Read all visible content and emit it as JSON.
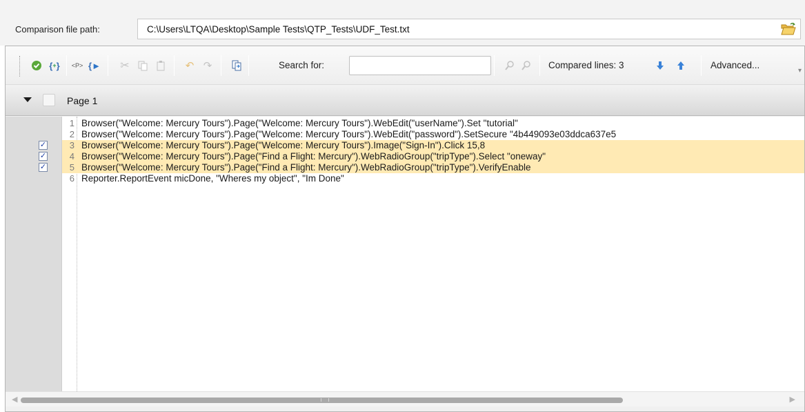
{
  "path": {
    "label": "Comparison file path:",
    "value": "C:\\Users\\LTQA\\Desktop\\Sample Tests\\QTP_Tests\\UDF_Test.txt",
    "browse_icon": "folder-open-icon"
  },
  "toolbar": {
    "icons": [
      "check-green-icon",
      "insert-function-icon",
      "insert-parameter-icon",
      "step-into-function-icon",
      "cut-icon",
      "copy-icon",
      "paste-icon",
      "undo-icon",
      "redo-icon",
      "copy-steps-icon",
      "find-icon",
      "find-next-icon",
      "arrow-down-icon",
      "arrow-up-icon"
    ],
    "search_label": "Search for:",
    "search_value": "",
    "compared_label": "Compared lines: 3",
    "advanced_label": "Advanced..."
  },
  "page_header": {
    "title": "Page 1",
    "expanded": true,
    "checked": false
  },
  "lines": [
    {
      "num": "1",
      "text": "Browser(\"Welcome: Mercury Tours\").Page(\"Welcome: Mercury Tours\").WebEdit(\"userName\").Set \"tutorial\"",
      "highlighted": false,
      "checked": false
    },
    {
      "num": "2",
      "text": "Browser(\"Welcome: Mercury Tours\").Page(\"Welcome: Mercury Tours\").WebEdit(\"password\").SetSecure \"4b449093e03ddca637e5",
      "highlighted": false,
      "checked": false
    },
    {
      "num": "3",
      "text": "Browser(\"Welcome: Mercury Tours\").Page(\"Welcome: Mercury Tours\").Image(\"Sign-In\").Click 15,8",
      "highlighted": true,
      "checked": true
    },
    {
      "num": "4",
      "text": "Browser(\"Welcome: Mercury Tours\").Page(\"Find a Flight: Mercury\").WebRadioGroup(\"tripType\").Select \"oneway\"",
      "highlighted": true,
      "checked": true
    },
    {
      "num": "5",
      "text": "Browser(\"Welcome: Mercury Tours\").Page(\"Find a Flight: Mercury\").WebRadioGroup(\"tripType\").VerifyEnable",
      "highlighted": true,
      "checked": true
    },
    {
      "num": "6",
      "text": "Reporter.ReportEvent micDone, \"Wheres my object\", \"Im Done\"",
      "highlighted": false,
      "checked": false
    }
  ],
  "colors": {
    "highlight": "#ffeab4",
    "gutter": "#dcdcdc",
    "checkmark": "#1d3fa5"
  }
}
